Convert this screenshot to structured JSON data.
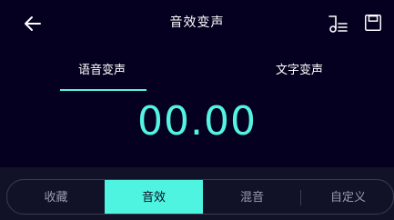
{
  "header": {
    "title": "音效变声",
    "back_icon": "arrow-left-icon",
    "music_icon": "music-note-list-icon",
    "save_icon": "save-icon"
  },
  "tabs": [
    {
      "label": "语音变声",
      "active": true
    },
    {
      "label": "文字变声",
      "active": false
    }
  ],
  "timer": {
    "value": "00.00"
  },
  "bottom_segments": [
    {
      "label": "收藏",
      "active": false
    },
    {
      "label": "音效",
      "active": true
    },
    {
      "label": "混音",
      "active": false
    },
    {
      "label": "自定义",
      "active": false
    }
  ],
  "colors": {
    "background": "#05001f",
    "accent": "#54f3e2",
    "panel": "#111228"
  }
}
